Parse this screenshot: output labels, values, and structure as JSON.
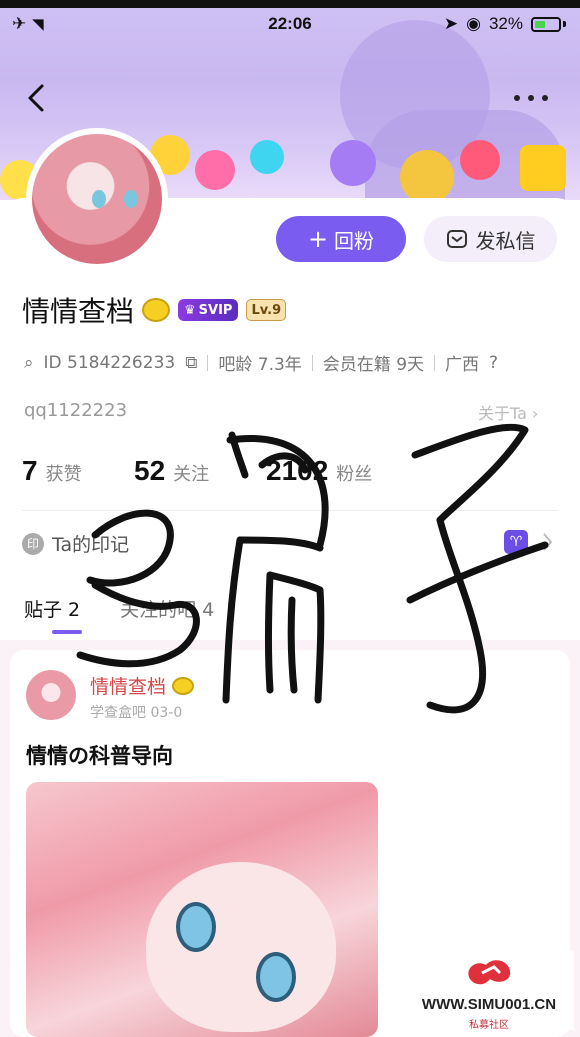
{
  "status_bar": {
    "time": "22:06",
    "battery": "32%"
  },
  "header": {
    "back_icon": "chevron-left-icon",
    "more_icon": "ellipsis-icon"
  },
  "actions": {
    "follow_label": "回粉",
    "message_label": "发私信"
  },
  "profile": {
    "name": "情情查档",
    "svip_label": "SVIP",
    "level_label": "Lv.9",
    "id_text": "ID 5184226233",
    "bar_age": "吧龄 7.3年",
    "membership": "会员在籍 9天",
    "location": "广西",
    "qq": "qq1122223",
    "about_label": "关于Ta",
    "stats": {
      "likes_value": "7",
      "likes_label": "获赞",
      "following_value": "52",
      "following_label": "关注",
      "followers_value": "2102",
      "followers_label": "粉丝"
    },
    "marks_label": "Ta的印记",
    "marks_icon_text": "印",
    "zodiac_symbol": "♈"
  },
  "tabs": [
    {
      "label": "贴子 2"
    },
    {
      "label": "关注的吧 4"
    }
  ],
  "post": {
    "author": "情情查档",
    "meta": "学查盒吧  03-0",
    "title": "情情の科普导向"
  },
  "watermark": {
    "site": "WWW.SIMU001.CN",
    "sub": "私募社区"
  },
  "colors": {
    "accent": "#7a5cf0",
    "name_red": "#d04a4a"
  }
}
